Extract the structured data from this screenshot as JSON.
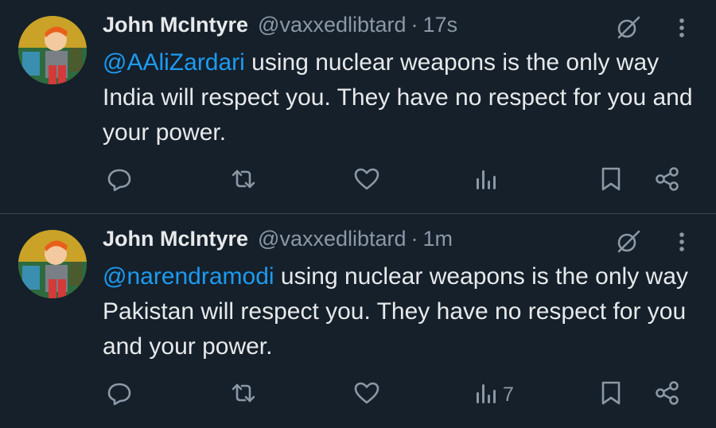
{
  "tweets": [
    {
      "author_name": "John McIntyre",
      "handle": "@vaxxedlibtard",
      "separator": "·",
      "time": "17s",
      "mention": "@AAliZardari",
      "body": " using nuclear weapons is the only way India will respect you. They have no respect for you and your power.",
      "views_count": ""
    },
    {
      "author_name": "John McIntyre",
      "handle": "@vaxxedlibtard",
      "separator": "·",
      "time": "1m",
      "mention": "@narendramodi",
      "body": " using nuclear weapons is the only way Pakistan will respect you. They have no respect for you and your power.",
      "views_count": "7"
    }
  ],
  "icons": {
    "reply": "reply-icon",
    "retweet": "retweet-icon",
    "like": "heart-icon",
    "views": "views-icon",
    "bookmark": "bookmark-icon",
    "share": "share-icon",
    "grok": "grok-icon",
    "more": "more-icon"
  },
  "colors": {
    "background": "#15202b",
    "text": "#e7e9ea",
    "muted": "#8b98a5",
    "link": "#1d9bf0",
    "divider": "#38444d"
  }
}
